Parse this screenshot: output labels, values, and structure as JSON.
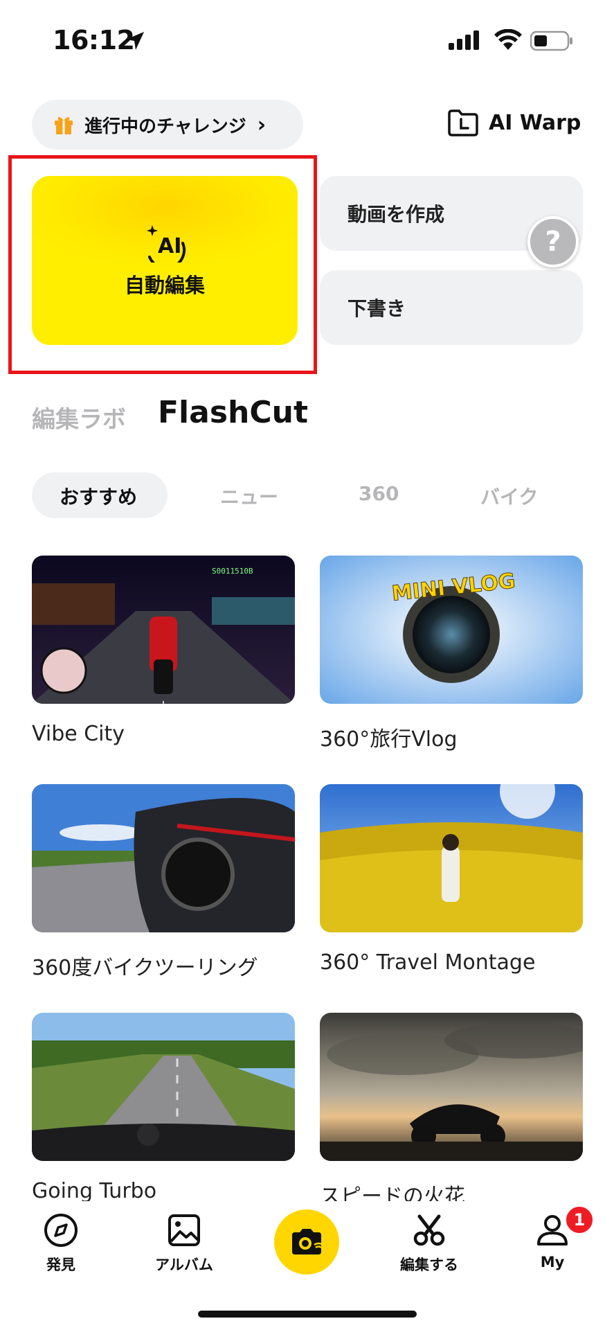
{
  "status_bar": {
    "time": "16:12"
  },
  "header": {
    "challenge_label": "進行中のチャレンジ",
    "ai_warp_label": "AI Warp"
  },
  "cards": {
    "auto_edit_label": "自動編集",
    "create_video_label": "動画を作成",
    "drafts_label": "下書き",
    "help_label": "?"
  },
  "section_tabs": [
    {
      "label": "編集ラボ",
      "active": false
    },
    {
      "label": "FlashCut",
      "active": true
    }
  ],
  "category_tabs": [
    {
      "label": "おすすめ",
      "active": true
    },
    {
      "label": "ニュー",
      "active": false
    },
    {
      "label": "360",
      "active": false
    },
    {
      "label": "バイク",
      "active": false
    }
  ],
  "templates": [
    {
      "title": "Vibe City",
      "overlay": "S0011510B"
    },
    {
      "title": "360°旅行Vlog",
      "overlay": "MINI VLOG"
    },
    {
      "title": "360度バイクツーリング"
    },
    {
      "title": "360° Travel Montage"
    },
    {
      "title": "Going Turbo"
    },
    {
      "title": "スピードの火花"
    }
  ],
  "bottom_nav": [
    {
      "label": "発見",
      "icon": "compass-icon"
    },
    {
      "label": "アルバム",
      "icon": "photo-icon"
    },
    {
      "label": "",
      "icon": "camera-icon"
    },
    {
      "label": "編集する",
      "icon": "scissors-icon"
    },
    {
      "label": "My",
      "icon": "user-icon"
    }
  ],
  "notification_count": "1",
  "colors": {
    "accent": "#FFE600",
    "highlight_frame": "#E8141B",
    "badge": "#EE1C25"
  }
}
